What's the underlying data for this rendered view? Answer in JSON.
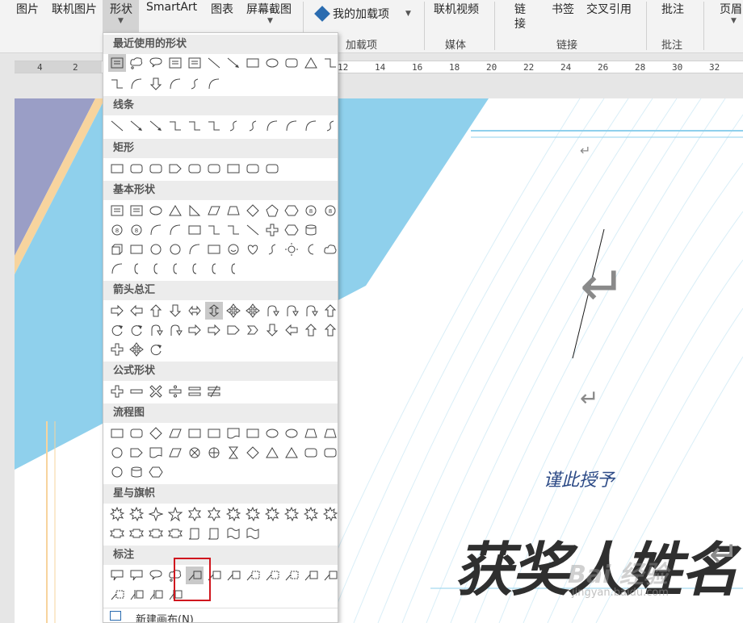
{
  "ribbon": {
    "buttons": {
      "pictures": "图片",
      "online_pictures": "联机图片",
      "shapes": "形状",
      "smartart": "SmartArt",
      "chart": "图表",
      "screenshot": "屏幕截图",
      "my_addins": "我的加载项",
      "online_video": "联机视频",
      "link_1": "链",
      "link_2": "接",
      "bookmark": "书签",
      "cross_reference": "交叉引用",
      "comment": "批注",
      "header": "页眉"
    },
    "groups": {
      "addins": "加载项",
      "media": "媒体",
      "links": "链接",
      "comments": "批注"
    }
  },
  "ruler": {
    "labels": [
      "4",
      "2",
      "12",
      "14",
      "16",
      "18",
      "20",
      "22",
      "24",
      "26",
      "28",
      "30",
      "32"
    ]
  },
  "shapes_menu": {
    "sections": {
      "recent": "最近使用的形状",
      "lines": "线条",
      "rectangles": "矩形",
      "basic": "基本形状",
      "arrows": "箭头总汇",
      "equation": "公式形状",
      "flowchart": "流程图",
      "stars": "星与旗帜",
      "callouts": "标注"
    },
    "new_canvas": "新建画布(N)"
  },
  "document": {
    "caption": "谨此授予",
    "name": "获奖人姓名",
    "paragraph_mark": "↵"
  },
  "watermark": {
    "logo": "Bai 经验",
    "url": "jingyan.baidu.com"
  },
  "colors": {
    "accent_blue": "#8fd0ec",
    "lavender": "#9a9ec6",
    "peach": "#f7d49e",
    "highlight_red": "#d0161e"
  }
}
